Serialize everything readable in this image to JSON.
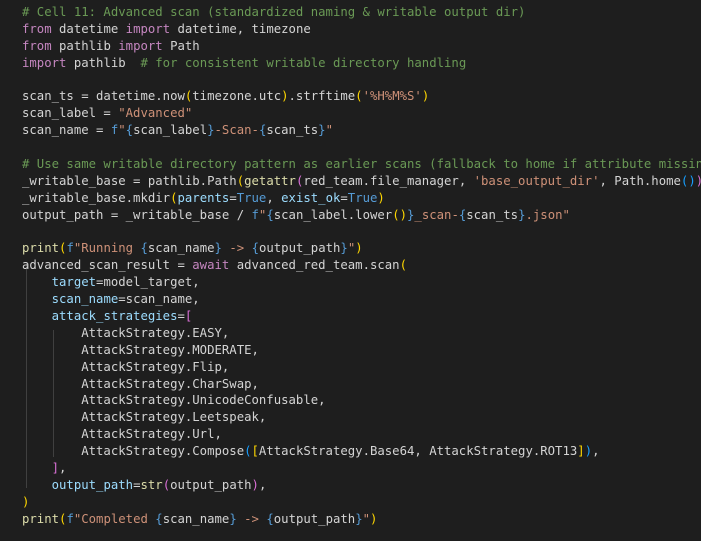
{
  "editor": {
    "lines": [
      [
        [
          "cmt",
          "# Cell 11: Advanced scan (standardized naming & writable output dir)"
        ]
      ],
      [
        [
          "kw",
          "from"
        ],
        [
          "plain",
          " datetime "
        ],
        [
          "kw",
          "import"
        ],
        [
          "plain",
          " datetime, timezone"
        ]
      ],
      [
        [
          "kw",
          "from"
        ],
        [
          "plain",
          " pathlib "
        ],
        [
          "kw",
          "import"
        ],
        [
          "plain",
          " Path"
        ]
      ],
      [
        [
          "kw",
          "import"
        ],
        [
          "plain",
          " pathlib  "
        ],
        [
          "cmt",
          "# for consistent writable directory handling"
        ]
      ],
      [],
      [
        [
          "plain",
          "scan_ts = datetime.now"
        ],
        [
          "b1",
          "("
        ],
        [
          "plain",
          "timezone.utc"
        ],
        [
          "b1",
          ")"
        ],
        [
          "plain",
          ".strftime"
        ],
        [
          "b1",
          "("
        ],
        [
          "str",
          "'%H%M%S'"
        ],
        [
          "b1",
          ")"
        ]
      ],
      [
        [
          "plain",
          "scan_label = "
        ],
        [
          "str",
          "\"Advanced\""
        ]
      ],
      [
        [
          "plain",
          "scan_name = "
        ],
        [
          "const",
          "f"
        ],
        [
          "str",
          "\""
        ],
        [
          "const",
          "{"
        ],
        [
          "plain",
          "scan_label"
        ],
        [
          "const",
          "}"
        ],
        [
          "str",
          "-Scan-"
        ],
        [
          "const",
          "{"
        ],
        [
          "plain",
          "scan_ts"
        ],
        [
          "const",
          "}"
        ],
        [
          "str",
          "\""
        ]
      ],
      [],
      [
        [
          "cmt",
          "# Use same writable directory pattern as earlier scans (fallback to home if attribute missing)"
        ]
      ],
      [
        [
          "plain",
          "_writable_base = pathlib.Path"
        ],
        [
          "b1",
          "("
        ],
        [
          "fn",
          "getattr"
        ],
        [
          "b2",
          "("
        ],
        [
          "plain",
          "red_team.file_manager, "
        ],
        [
          "str",
          "'base_output_dir'"
        ],
        [
          "plain",
          ", Path.home"
        ],
        [
          "b3",
          "()"
        ],
        [
          "b2",
          ")"
        ],
        [
          "b1",
          ")"
        ]
      ],
      [
        [
          "plain",
          "_writable_base.mkdir"
        ],
        [
          "b1",
          "("
        ],
        [
          "var",
          "parents"
        ],
        [
          "plain",
          "="
        ],
        [
          "const",
          "True"
        ],
        [
          "plain",
          ", "
        ],
        [
          "var",
          "exist_ok"
        ],
        [
          "plain",
          "="
        ],
        [
          "const",
          "True"
        ],
        [
          "b1",
          ")"
        ]
      ],
      [
        [
          "plain",
          "output_path = _writable_base / "
        ],
        [
          "const",
          "f"
        ],
        [
          "str",
          "\""
        ],
        [
          "const",
          "{"
        ],
        [
          "plain",
          "scan_label.lower"
        ],
        [
          "b1",
          "()"
        ],
        [
          "const",
          "}"
        ],
        [
          "str",
          "_scan-"
        ],
        [
          "const",
          "{"
        ],
        [
          "plain",
          "scan_ts"
        ],
        [
          "const",
          "}"
        ],
        [
          "str",
          ".json\""
        ]
      ],
      [],
      [
        [
          "fn",
          "print"
        ],
        [
          "b1",
          "("
        ],
        [
          "const",
          "f"
        ],
        [
          "str",
          "\"Running "
        ],
        [
          "const",
          "{"
        ],
        [
          "plain",
          "scan_name"
        ],
        [
          "const",
          "}"
        ],
        [
          "str",
          " -> "
        ],
        [
          "const",
          "{"
        ],
        [
          "plain",
          "output_path"
        ],
        [
          "const",
          "}"
        ],
        [
          "str",
          "\""
        ],
        [
          "b1",
          ")"
        ]
      ],
      [
        [
          "plain",
          "advanced_scan_result = "
        ],
        [
          "kw",
          "await"
        ],
        [
          "plain",
          " advanced_red_team.scan"
        ],
        [
          "b1",
          "("
        ]
      ],
      [
        [
          "plain",
          "    "
        ],
        [
          "var",
          "target"
        ],
        [
          "plain",
          "=model_target,"
        ]
      ],
      [
        [
          "plain",
          "    "
        ],
        [
          "var",
          "scan_name"
        ],
        [
          "plain",
          "=scan_name,"
        ]
      ],
      [
        [
          "plain",
          "    "
        ],
        [
          "var",
          "attack_strategies"
        ],
        [
          "plain",
          "="
        ],
        [
          "b2",
          "["
        ]
      ],
      [
        [
          "plain",
          "        AttackStrategy.EASY,"
        ]
      ],
      [
        [
          "plain",
          "        AttackStrategy.MODERATE,"
        ]
      ],
      [
        [
          "plain",
          "        AttackStrategy.Flip,"
        ]
      ],
      [
        [
          "plain",
          "        AttackStrategy.CharSwap,"
        ]
      ],
      [
        [
          "plain",
          "        AttackStrategy.UnicodeConfusable,"
        ]
      ],
      [
        [
          "plain",
          "        AttackStrategy.Leetspeak,"
        ]
      ],
      [
        [
          "plain",
          "        AttackStrategy.Url,"
        ]
      ],
      [
        [
          "plain",
          "        AttackStrategy.Compose"
        ],
        [
          "b3",
          "("
        ],
        [
          "b1",
          "["
        ],
        [
          "plain",
          "AttackStrategy.Base64, AttackStrategy.ROT13"
        ],
        [
          "b1",
          "]"
        ],
        [
          "b3",
          ")"
        ],
        [
          "plain",
          ","
        ]
      ],
      [
        [
          "plain",
          "    "
        ],
        [
          "b2",
          "]"
        ],
        [
          "plain",
          ","
        ]
      ],
      [
        [
          "plain",
          "    "
        ],
        [
          "var",
          "output_path"
        ],
        [
          "plain",
          "="
        ],
        [
          "fn",
          "str"
        ],
        [
          "b2",
          "("
        ],
        [
          "plain",
          "output_path"
        ],
        [
          "b2",
          ")"
        ],
        [
          "plain",
          ","
        ]
      ],
      [
        [
          "b1",
          ")"
        ]
      ],
      [
        [
          "fn",
          "print"
        ],
        [
          "b1",
          "("
        ],
        [
          "const",
          "f"
        ],
        [
          "str",
          "\"Completed "
        ],
        [
          "const",
          "{"
        ],
        [
          "plain",
          "scan_name"
        ],
        [
          "const",
          "}"
        ],
        [
          "str",
          " -> "
        ],
        [
          "const",
          "{"
        ],
        [
          "plain",
          "output_path"
        ],
        [
          "const",
          "}"
        ],
        [
          "str",
          "\""
        ],
        [
          "b1",
          ")"
        ]
      ]
    ]
  }
}
